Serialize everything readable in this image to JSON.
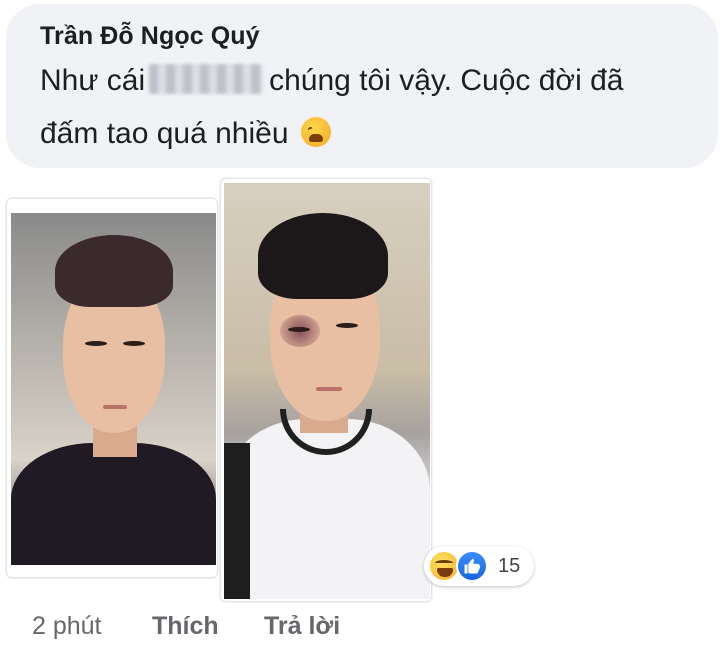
{
  "comment": {
    "author": "Trần Đỗ Ngọc Quý",
    "text_before_blur": "Như cái",
    "text_after_blur": "chúng tôi vậy. Cuộc đời đã",
    "text_line2": "đấm tao quá nhiều",
    "emoji": "weary-face-emoji"
  },
  "photos": [
    {
      "name": "photo-before",
      "description_icon": "portrait-photo"
    },
    {
      "name": "photo-after",
      "description_icon": "portrait-photo"
    }
  ],
  "reactions": {
    "icons": [
      "haha-reaction-icon",
      "like-reaction-icon"
    ],
    "count": "15",
    "like_color": "#1877f2"
  },
  "actions": {
    "time": "2 phút",
    "like_label": "Thích",
    "reply_label": "Trả lời"
  },
  "colors": {
    "bubble_bg": "#f0f2f5",
    "text": "#1c1e21",
    "meta_text": "#65676b"
  }
}
